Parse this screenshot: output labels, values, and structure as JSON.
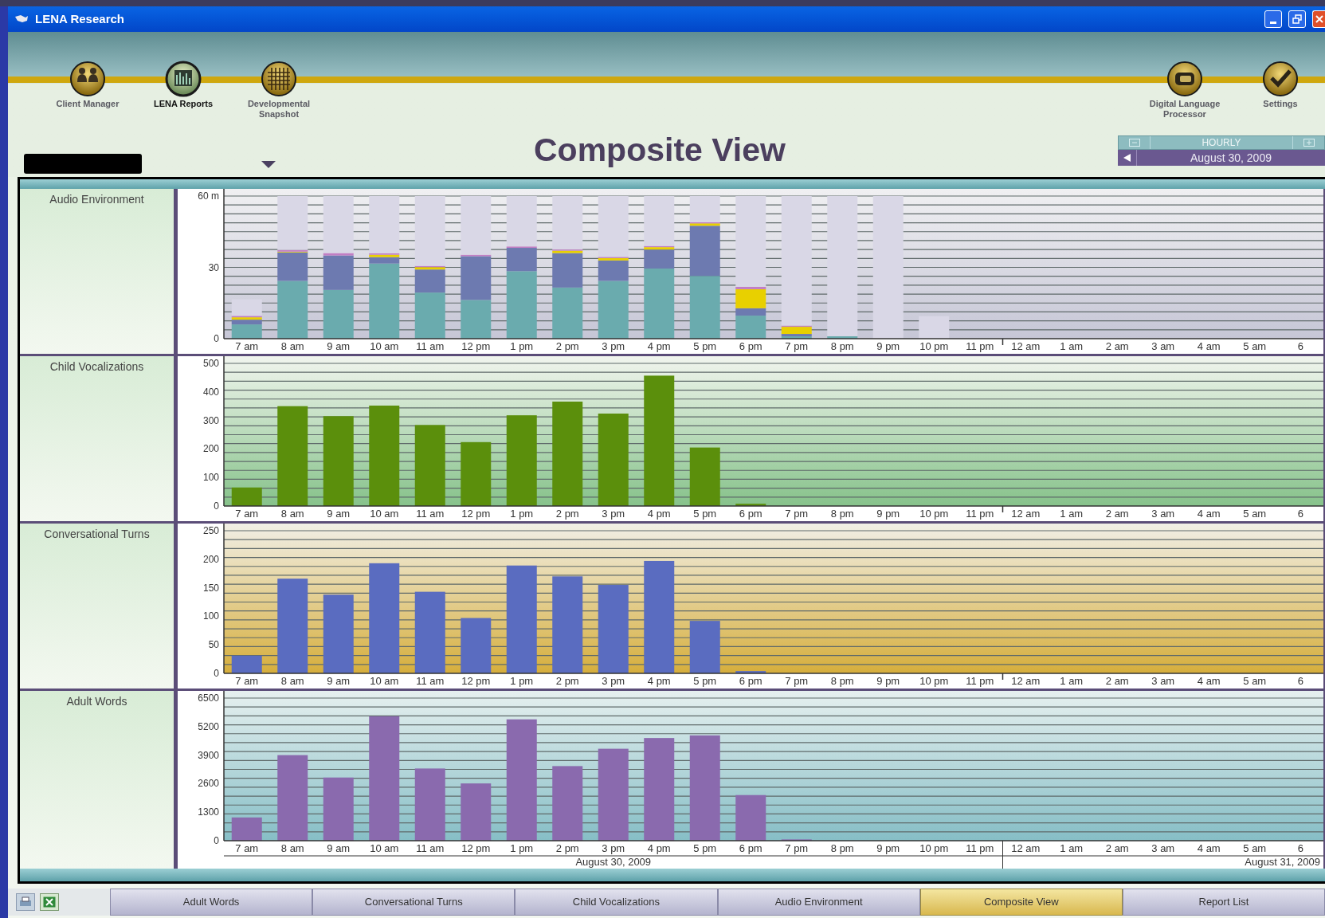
{
  "window": {
    "title": "LENA Research"
  },
  "nav": [
    {
      "label": "Client Manager",
      "selected": false
    },
    {
      "label": "LENA Reports",
      "selected": true
    },
    {
      "label": "Developmental Snapshot",
      "selected": false
    },
    {
      "label": "Digital Language Processor",
      "selected": false
    },
    {
      "label": "Settings",
      "selected": false
    }
  ],
  "page_title": "Composite View",
  "period": {
    "mode": "HOURLY",
    "date": "August 30, 2009"
  },
  "charts": [
    {
      "chart_data": {
        "type": "bar",
        "title": "Audio Environment",
        "stacked": true,
        "categories": [
          "7 am",
          "8 am",
          "9 am",
          "10 am",
          "11 am",
          "12 pm",
          "1 pm",
          "2 pm",
          "3 pm",
          "4 pm",
          "5 pm",
          "6 pm",
          "7 pm",
          "8 pm",
          "9 pm",
          "10 pm",
          "11 pm",
          "12 am",
          "1 am",
          "2 am",
          "3 am",
          "4 am",
          "5 am",
          "6"
        ],
        "ylim": [
          0,
          60
        ],
        "yticks": [
          0,
          30,
          {
            "value": 60,
            "label": "60 m"
          }
        ],
        "series": [
          {
            "color": "#6aabae",
            "values": [
              6,
              24.3,
              20.5,
              31.6,
              19.4,
              16.3,
              28.4,
              21.5,
              24.3,
              29.5,
              26.4,
              9.7,
              1,
              1,
              0,
              0,
              0,
              0,
              0,
              0,
              0,
              0,
              0,
              0
            ]
          },
          {
            "color": "#6d7ab0",
            "values": [
              2,
              12,
              14.5,
              2.7,
              9.7,
              18.4,
              9.8,
              14.5,
              8.6,
              8,
              21.1,
              3.1,
              1,
              0,
              0,
              0,
              0,
              0,
              0,
              0,
              0,
              0,
              0,
              0
            ]
          },
          {
            "color": "#e8d000",
            "values": [
              1,
              0.3,
              0,
              1,
              1,
              0,
              0,
              1,
              1,
              1,
              1,
              8,
              3,
              0,
              0,
              0,
              0,
              0,
              0,
              0,
              0,
              0,
              0,
              0
            ]
          },
          {
            "color": "#c27ec4",
            "values": [
              0.6,
              0.7,
              1,
              0.6,
              0.5,
              0.6,
              0.6,
              0.5,
              0.5,
              0.5,
              0.5,
              1,
              0.5,
              0,
              0,
              0,
              0,
              0,
              0,
              0,
              0,
              0,
              0,
              0
            ]
          },
          {
            "color": "#d9d7e6",
            "values": [
              7,
              22.7,
              24,
              24.1,
              29.4,
              24.7,
              21.2,
              22.5,
              25.6,
              21,
              11,
              38.2,
              54.5,
              59,
              60,
              9.5,
              0,
              0,
              0,
              0,
              0,
              0,
              0,
              0
            ]
          }
        ]
      }
    },
    {
      "chart_data": {
        "type": "bar",
        "title": "Child Vocalizations",
        "categories": [
          "7 am",
          "8 am",
          "9 am",
          "10 am",
          "11 am",
          "12 pm",
          "1 pm",
          "2 pm",
          "3 pm",
          "4 pm",
          "5 pm",
          "6 pm",
          "7 pm",
          "8 pm",
          "9 pm",
          "10 pm",
          "11 pm",
          "12 am",
          "1 am",
          "2 am",
          "3 am",
          "4 am",
          "5 am",
          "6"
        ],
        "ylim": [
          0,
          500
        ],
        "yticks": [
          0,
          100,
          200,
          300,
          400,
          500
        ],
        "series": [
          {
            "color": "#5b8f0c",
            "values": [
              65,
              350,
              315,
              352,
              284,
              224,
              318,
              366,
              324,
              457,
              205,
              8,
              0,
              0,
              0,
              0,
              0,
              0,
              0,
              0,
              0,
              0,
              0,
              0
            ]
          }
        ]
      }
    },
    {
      "chart_data": {
        "type": "bar",
        "title": "Conversational Turns",
        "categories": [
          "7 am",
          "8 am",
          "9 am",
          "10 am",
          "11 am",
          "12 pm",
          "1 pm",
          "2 pm",
          "3 pm",
          "4 pm",
          "5 pm",
          "6 pm",
          "7 pm",
          "8 pm",
          "9 pm",
          "10 pm",
          "11 pm",
          "12 am",
          "1 am",
          "2 am",
          "3 am",
          "4 am",
          "5 am",
          "6"
        ],
        "ylim": [
          0,
          250
        ],
        "yticks": [
          0,
          50,
          100,
          150,
          200,
          250
        ],
        "series": [
          {
            "color": "#5a6cc0",
            "values": [
              31,
              166,
              138,
              193,
              143,
              97,
              189,
              170,
              155,
              197,
              92,
              4,
              0,
              0,
              0,
              0,
              0,
              0,
              0,
              0,
              0,
              0,
              0,
              0
            ]
          }
        ]
      }
    },
    {
      "chart_data": {
        "type": "bar",
        "title": "Adult Words",
        "categories": [
          "7 am",
          "8 am",
          "9 am",
          "10 am",
          "11 am",
          "12 pm",
          "1 pm",
          "2 pm",
          "3 pm",
          "4 pm",
          "5 pm",
          "6 pm",
          "7 pm",
          "8 pm",
          "9 pm",
          "10 pm",
          "11 pm",
          "12 am",
          "1 am",
          "2 am",
          "3 am",
          "4 am",
          "5 am",
          "6"
        ],
        "ylim": [
          0,
          6500
        ],
        "yticks": [
          0,
          1300,
          2600,
          3900,
          5200,
          6500
        ],
        "series": [
          {
            "color": "#8a6aae",
            "values": [
              1060,
              3900,
              2880,
              5670,
              3290,
              2610,
              5530,
              3400,
              4190,
              4680,
              4800,
              2080,
              60,
              0,
              0,
              0,
              0,
              0,
              0,
              0,
              0,
              0,
              0,
              0
            ]
          }
        ]
      }
    }
  ],
  "date_axis": [
    "August 30, 2009",
    "August 31, 2009"
  ],
  "tabs": [
    {
      "label": "Adult Words",
      "selected": false
    },
    {
      "label": "Conversational Turns",
      "selected": false
    },
    {
      "label": "Child Vocalizations",
      "selected": false
    },
    {
      "label": "Audio Environment",
      "selected": false
    },
    {
      "label": "Composite View",
      "selected": true
    },
    {
      "label": "Report List",
      "selected": false
    }
  ]
}
